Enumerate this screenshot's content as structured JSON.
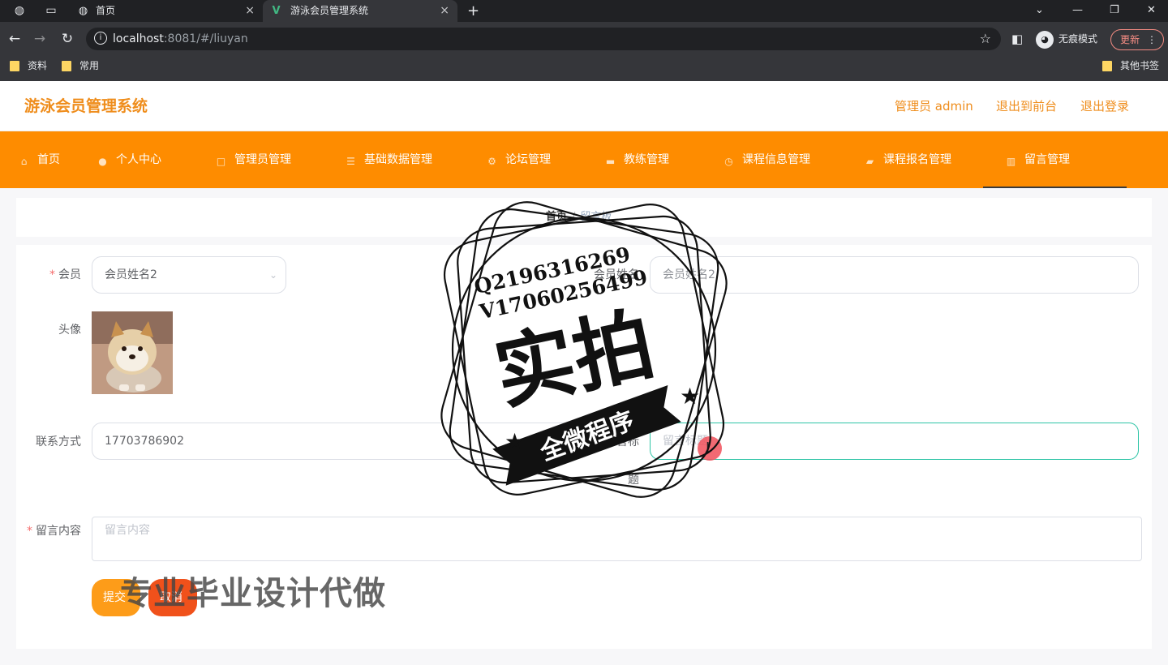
{
  "browser": {
    "tabs": [
      {
        "title": "首页",
        "close": "×"
      },
      {
        "title": "游泳会员管理系统",
        "close": "×"
      }
    ],
    "new_tab": "+",
    "window_controls": {
      "chevron": "⌄",
      "minimize": "—",
      "restore": "❐",
      "close": "✕"
    },
    "url_host": "localhost",
    "url_rest": ":8081/#/liuyan",
    "incognito_label": "无痕模式",
    "update_label": "更新",
    "bookmarks": [
      "资料",
      "常用"
    ],
    "other_bookmarks": "其他书签"
  },
  "header": {
    "brand": "游泳会员管理系统",
    "admin": "管理员 admin",
    "to_front": "退出到前台",
    "logout": "退出登录"
  },
  "nav": [
    {
      "label": "首页",
      "icon": "home-icon"
    },
    {
      "label": "个人中心",
      "icon": "user-icon"
    },
    {
      "label": "管理员管理",
      "icon": "square-icon"
    },
    {
      "label": "基础数据管理",
      "icon": "list-icon"
    },
    {
      "label": "论坛管理",
      "icon": "settings-icon"
    },
    {
      "label": "教练管理",
      "icon": "folder-icon"
    },
    {
      "label": "课程信息管理",
      "icon": "clock-icon"
    },
    {
      "label": "课程报名管理",
      "icon": "cart-icon"
    },
    {
      "label": "留言管理",
      "icon": "chart-icon"
    }
  ],
  "breadcrumb": {
    "home": "首页",
    "sep": "/",
    "current": "留言板"
  },
  "form": {
    "member_label": "会员",
    "member_value": "会员姓名2",
    "member_name_label": "会员姓名",
    "member_name_value": "会员姓名2",
    "avatar_label": "头像",
    "phone_label": "联系方式",
    "phone_value": "17703786902",
    "title_label_1": "留言标",
    "title_label_2": "题",
    "title_placeholder": "留言标题",
    "content_label": "留言内容",
    "content_placeholder": "留言内容",
    "submit": "提交",
    "cancel": "取消"
  },
  "watermark": {
    "qq": "Q2196316269",
    "wx": "V17060256499",
    "big": "实拍",
    "banner": "全微程序",
    "bottom": "专业毕业设计代做"
  },
  "colors": {
    "accent": "#fe8c00",
    "brand_text": "#ef8d1c",
    "focus": "#2ec4a6",
    "required": "#f56c6c"
  }
}
